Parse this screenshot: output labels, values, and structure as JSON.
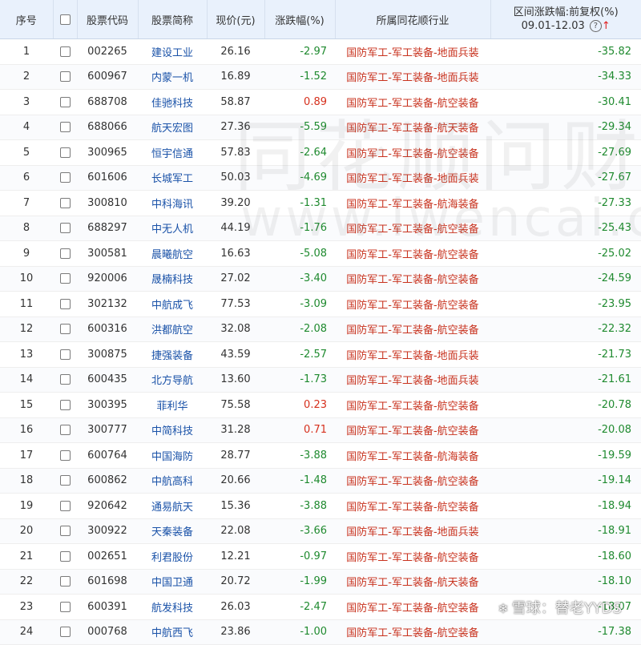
{
  "headers": {
    "no": "序号",
    "code": "股票代码",
    "name": "股票简称",
    "price": "现价(元)",
    "change": "涨跌幅(%)",
    "industry": "所属同花顺行业",
    "range_line1": "区间涨跌幅:前复权(%)",
    "range_line2": "09.01-12.03"
  },
  "colors": {
    "up": "#d6301d",
    "down": "#1f8a2f",
    "name": "#1a52a8",
    "industry": "#c8321e",
    "header_bg": "#e9f1fc"
  },
  "icons": {
    "help": "question-circle-icon",
    "sort": "sort-arrow-up-icon"
  },
  "watermark": {
    "text": "同花顺问财",
    "url": "www.iwencai.com"
  },
  "credit": {
    "text": "雪球：替老YYDS"
  },
  "rows": [
    {
      "no": "1",
      "code": "002265",
      "name": "建设工业",
      "price": "26.16",
      "change": "-2.97",
      "industry": "国防军工-军工装备-地面兵装",
      "range": "-35.82"
    },
    {
      "no": "2",
      "code": "600967",
      "name": "内蒙一机",
      "price": "16.89",
      "change": "-1.52",
      "industry": "国防军工-军工装备-地面兵装",
      "range": "-34.33"
    },
    {
      "no": "3",
      "code": "688708",
      "name": "佳驰科技",
      "price": "58.87",
      "change": "0.89",
      "industry": "国防军工-军工装备-航空装备",
      "range": "-30.41"
    },
    {
      "no": "4",
      "code": "688066",
      "name": "航天宏图",
      "price": "27.36",
      "change": "-5.59",
      "industry": "国防军工-军工装备-航天装备",
      "range": "-29.34"
    },
    {
      "no": "5",
      "code": "300965",
      "name": "恒宇信通",
      "price": "57.83",
      "change": "-2.64",
      "industry": "国防军工-军工装备-航空装备",
      "range": "-27.69"
    },
    {
      "no": "6",
      "code": "601606",
      "name": "长城军工",
      "price": "50.03",
      "change": "-4.69",
      "industry": "国防军工-军工装备-地面兵装",
      "range": "-27.67"
    },
    {
      "no": "7",
      "code": "300810",
      "name": "中科海讯",
      "price": "39.20",
      "change": "-1.31",
      "industry": "国防军工-军工装备-航海装备",
      "range": "-27.33"
    },
    {
      "no": "8",
      "code": "688297",
      "name": "中无人机",
      "price": "44.19",
      "change": "-1.76",
      "industry": "国防军工-军工装备-航空装备",
      "range": "-25.43"
    },
    {
      "no": "9",
      "code": "300581",
      "name": "晨曦航空",
      "price": "16.63",
      "change": "-5.08",
      "industry": "国防军工-军工装备-航空装备",
      "range": "-25.02"
    },
    {
      "no": "10",
      "code": "920006",
      "name": "晟楠科技",
      "price": "27.02",
      "change": "-3.40",
      "industry": "国防军工-军工装备-航空装备",
      "range": "-24.59"
    },
    {
      "no": "11",
      "code": "302132",
      "name": "中航成飞",
      "price": "77.53",
      "change": "-3.09",
      "industry": "国防军工-军工装备-航空装备",
      "range": "-23.95"
    },
    {
      "no": "12",
      "code": "600316",
      "name": "洪都航空",
      "price": "32.08",
      "change": "-2.08",
      "industry": "国防军工-军工装备-航空装备",
      "range": "-22.32"
    },
    {
      "no": "13",
      "code": "300875",
      "name": "捷强装备",
      "price": "43.59",
      "change": "-2.57",
      "industry": "国防军工-军工装备-地面兵装",
      "range": "-21.73"
    },
    {
      "no": "14",
      "code": "600435",
      "name": "北方导航",
      "price": "13.60",
      "change": "-1.73",
      "industry": "国防军工-军工装备-地面兵装",
      "range": "-21.61"
    },
    {
      "no": "15",
      "code": "300395",
      "name": "菲利华",
      "price": "75.58",
      "change": "0.23",
      "industry": "国防军工-军工装备-航空装备",
      "range": "-20.78"
    },
    {
      "no": "16",
      "code": "300777",
      "name": "中简科技",
      "price": "31.28",
      "change": "0.71",
      "industry": "国防军工-军工装备-航空装备",
      "range": "-20.08"
    },
    {
      "no": "17",
      "code": "600764",
      "name": "中国海防",
      "price": "28.77",
      "change": "-3.88",
      "industry": "国防军工-军工装备-航海装备",
      "range": "-19.59"
    },
    {
      "no": "18",
      "code": "600862",
      "name": "中航高科",
      "price": "20.66",
      "change": "-1.48",
      "industry": "国防军工-军工装备-航空装备",
      "range": "-19.14"
    },
    {
      "no": "19",
      "code": "920642",
      "name": "通易航天",
      "price": "15.36",
      "change": "-3.88",
      "industry": "国防军工-军工装备-航空装备",
      "range": "-18.94"
    },
    {
      "no": "20",
      "code": "300922",
      "name": "天秦装备",
      "price": "22.08",
      "change": "-3.66",
      "industry": "国防军工-军工装备-地面兵装",
      "range": "-18.91"
    },
    {
      "no": "21",
      "code": "002651",
      "name": "利君股份",
      "price": "12.21",
      "change": "-0.97",
      "industry": "国防军工-军工装备-航空装备",
      "range": "-18.60"
    },
    {
      "no": "22",
      "code": "601698",
      "name": "中国卫通",
      "price": "20.72",
      "change": "-1.99",
      "industry": "国防军工-军工装备-航天装备",
      "range": "-18.10"
    },
    {
      "no": "23",
      "code": "600391",
      "name": "航发科技",
      "price": "26.03",
      "change": "-2.47",
      "industry": "国防军工-军工装备-航空装备",
      "range": "-18.07"
    },
    {
      "no": "24",
      "code": "000768",
      "name": "中航西飞",
      "price": "23.86",
      "change": "-1.00",
      "industry": "国防军工-军工装备-航空装备",
      "range": "-17.38"
    }
  ]
}
